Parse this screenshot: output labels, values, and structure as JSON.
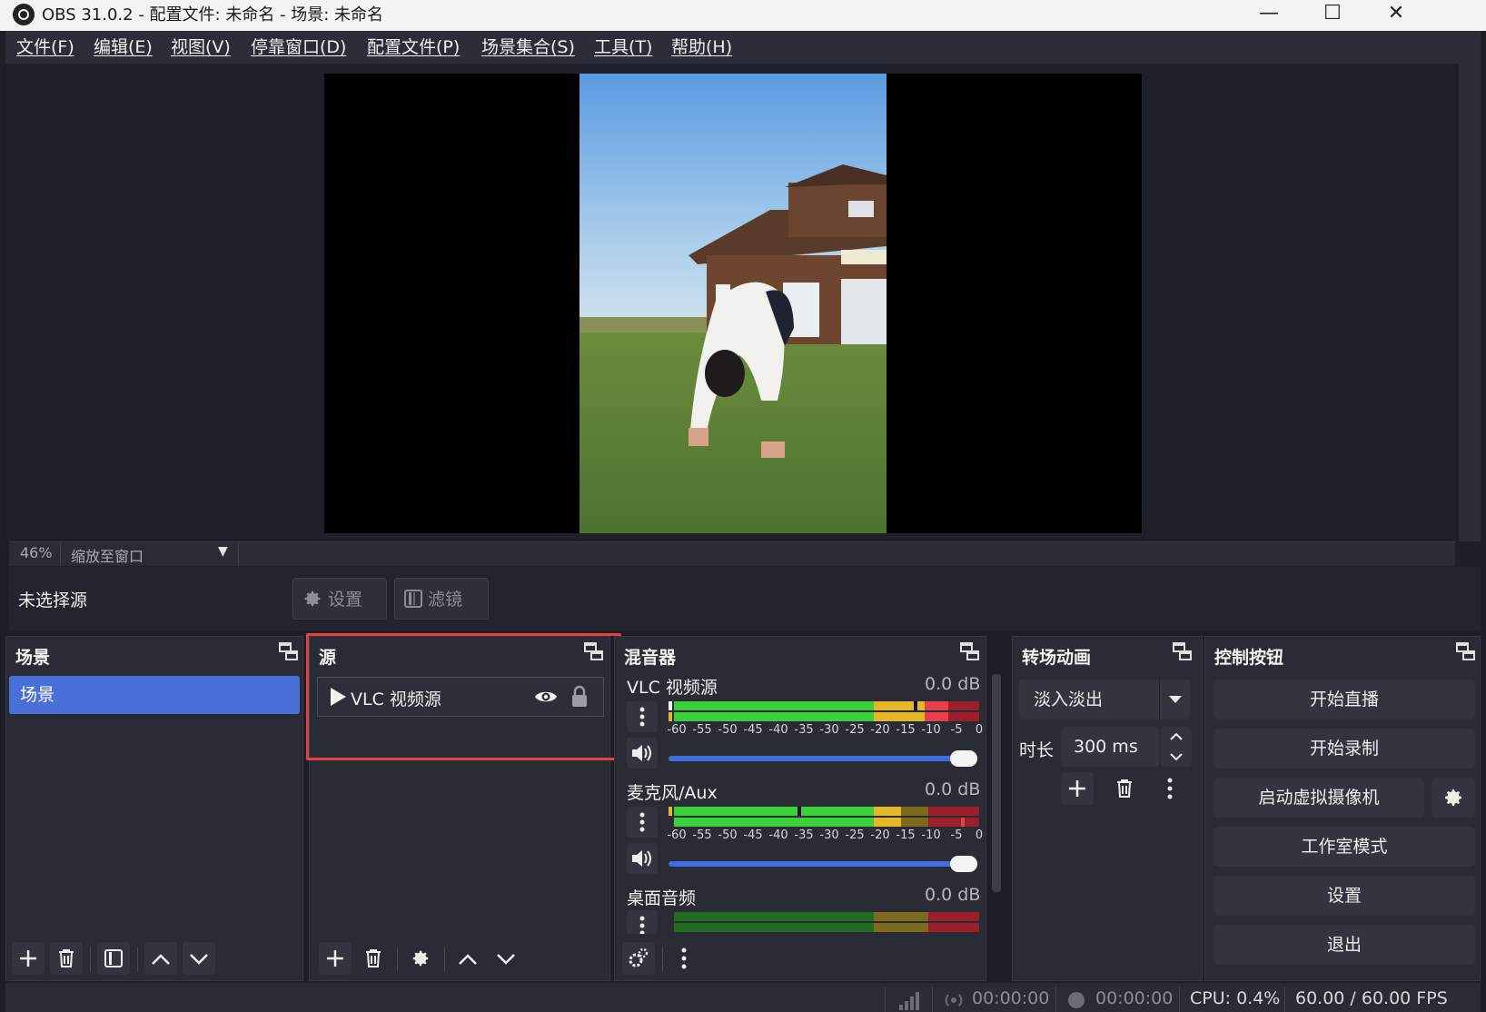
{
  "window": {
    "title": "OBS 31.0.2 - 配置文件: 未命名 - 场景: 未命名",
    "minimize_glyph": "—",
    "maximize_glyph": "☐",
    "close_glyph": "✕"
  },
  "menu": [
    "文件(F)",
    "编辑(E)",
    "视图(V)",
    "停靠窗口(D)",
    "配置文件(P)",
    "场景集合(S)",
    "工具(T)",
    "帮助(H)"
  ],
  "zoom": {
    "percent": "46%",
    "mode": "缩放至窗口",
    "arrow": "▼"
  },
  "context": {
    "label": "未选择源",
    "settings_label": "设置",
    "filters_label": "滤镜"
  },
  "scenes": {
    "title": "场景",
    "items": [
      "场景"
    ]
  },
  "sources": {
    "title": "源",
    "items": [
      {
        "name": "VLC 视频源",
        "visible": true,
        "locked": true
      }
    ]
  },
  "mixer": {
    "title": "混音器",
    "scale": [
      "-60",
      "-55",
      "-50",
      "-45",
      "-40",
      "-35",
      "-30",
      "-25",
      "-20",
      "-15",
      "-10",
      "-5",
      "0"
    ],
    "channels": [
      {
        "name": "VLC 视频源",
        "db": "0.0 dB",
        "volume": 1.0
      },
      {
        "name": "麦克风/Aux",
        "db": "0.0 dB",
        "volume": 1.0
      },
      {
        "name": "桌面音频",
        "db": "0.0 dB",
        "volume": 1.0
      }
    ]
  },
  "transitions": {
    "title": "转场动画",
    "selected": "淡入淡出",
    "duration_label": "时长",
    "duration_value": "300 ms"
  },
  "controls": {
    "title": "控制按钮",
    "start_stream": "开始直播",
    "start_record": "开始录制",
    "virtual_cam": "启动虚拟摄像机",
    "studio_mode": "工作室模式",
    "settings": "设置",
    "exit": "退出"
  },
  "status": {
    "stream_time": "00:00:00",
    "record_time": "00:00:00",
    "cpu": "CPU: 0.4%",
    "fps": "60.00 / 60.00 FPS"
  },
  "colors": {
    "accent": "#4b6fd9",
    "highlight": "#e8403f",
    "meter_green": "#3ccf3c",
    "meter_yellow": "#e4b62a",
    "meter_red": "#e8404a"
  }
}
